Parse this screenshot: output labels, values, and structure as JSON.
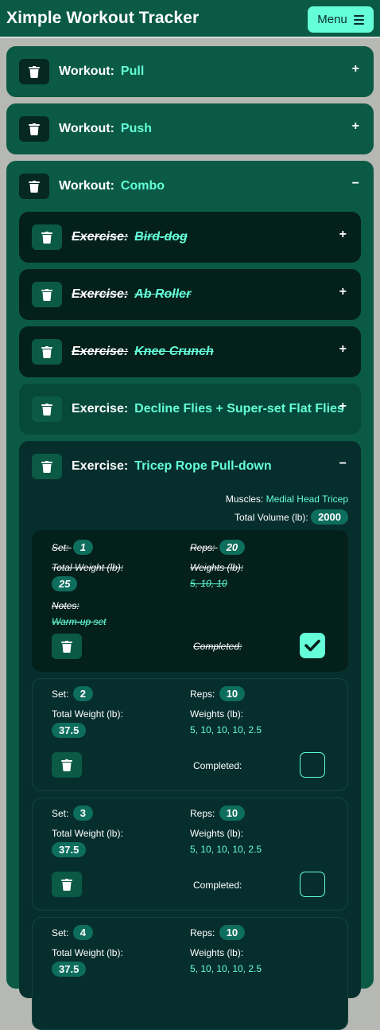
{
  "app": {
    "title": "Ximple Workout Tracker",
    "menu_label": "Menu"
  },
  "labels": {
    "workout": "Workout:",
    "exercise": "Exercise:",
    "collapsed_toggle": "+",
    "expanded_toggle": "−",
    "set": "Set:",
    "reps": "Reps:",
    "total_weight": "Total Weight (lb):",
    "weights": "Weights (lb):",
    "notes": "Notes:",
    "completed": "Completed:",
    "muscles": "Muscles:",
    "total_volume": "Total Volume (lb):"
  },
  "workouts": [
    {
      "name": "Pull",
      "expanded": false
    },
    {
      "name": "Push",
      "expanded": false
    },
    {
      "name": "Combo",
      "expanded": true
    }
  ],
  "exercises": [
    {
      "name": "Bird-dog",
      "done": true,
      "expanded": false
    },
    {
      "name": "Ab Roller",
      "done": true,
      "expanded": false
    },
    {
      "name": "Knee Crunch",
      "done": true,
      "expanded": false
    },
    {
      "name": "Decline Flies + Super-set Flat Flies",
      "done": false,
      "expanded": false
    },
    {
      "name": "Tricep Rope Pull-down",
      "done": false,
      "expanded": true
    }
  ],
  "active_exercise": {
    "muscles": "Medial Head Tricep",
    "total_volume": "2000"
  },
  "sets": [
    {
      "set": "1",
      "reps": "20",
      "total_weight": "25",
      "weights": "5, 10, 10",
      "notes": "Warm-up set",
      "completed": true
    },
    {
      "set": "2",
      "reps": "10",
      "total_weight": "37.5",
      "weights": "5, 10, 10, 10, 2.5",
      "completed": false
    },
    {
      "set": "3",
      "reps": "10",
      "total_weight": "37.5",
      "weights": "5, 10, 10, 10, 2.5",
      "completed": false
    },
    {
      "set": "4",
      "reps": "10",
      "total_weight": "37.5",
      "weights": "5, 10, 10, 10, 2.5",
      "completed": false
    }
  ],
  "colors": {
    "accent": "#64ffd8",
    "header": "#0b5a45",
    "dark_card": "#04201b",
    "open_card": "#062e2d",
    "page_bg": "#b6b8b3"
  },
  "icons": {
    "delete": "trash-icon",
    "menu": "hamburger-menu-icon",
    "completed": "checkmark-icon"
  }
}
